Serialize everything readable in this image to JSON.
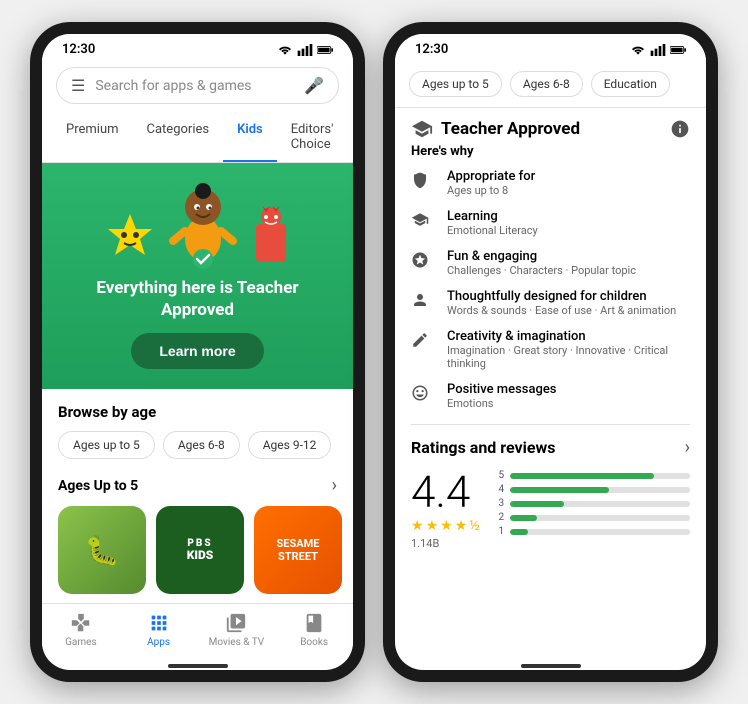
{
  "left_phone": {
    "status_time": "12:30",
    "search_placeholder": "Search for apps & games",
    "nav_tabs": [
      {
        "label": "Premium",
        "active": false
      },
      {
        "label": "Categories",
        "active": false
      },
      {
        "label": "Kids",
        "active": true
      },
      {
        "label": "Editors' Choice",
        "active": false
      }
    ],
    "hero": {
      "title": "Everything here is Teacher Approved",
      "learn_more_label": "Learn more"
    },
    "browse": {
      "title": "Browse by age",
      "chips": [
        {
          "label": "Ages up to 5",
          "active": false
        },
        {
          "label": "Ages 6-8",
          "active": false
        },
        {
          "label": "Ages 9-12",
          "active": false
        }
      ]
    },
    "ages_up_to_5": {
      "title": "Ages Up to 5",
      "apps": [
        {
          "name": "Caterpillar"
        },
        {
          "name": "PBS Kids"
        },
        {
          "name": "Sesame Street"
        }
      ]
    },
    "bottom_nav": [
      {
        "label": "Games",
        "active": false
      },
      {
        "label": "Apps",
        "active": true
      },
      {
        "label": "Movies & TV",
        "active": false
      },
      {
        "label": "Books",
        "active": false
      }
    ]
  },
  "right_phone": {
    "status_time": "12:30",
    "filter_chips": [
      {
        "label": "Ages up to 5",
        "active": false
      },
      {
        "label": "Ages 6-8",
        "active": false
      },
      {
        "label": "Education",
        "active": false
      }
    ],
    "teacher_section": {
      "title": "Teacher Approved",
      "heres_why": "Here's why",
      "reasons": [
        {
          "icon": "shield",
          "label": "Appropriate for",
          "detail": "Ages up to 8"
        },
        {
          "icon": "mortarboard",
          "label": "Learning",
          "detail": "Emotional Literacy"
        },
        {
          "icon": "star-outline",
          "label": "Fun & engaging",
          "detail": "Challenges · Characters · Popular topic"
        },
        {
          "icon": "child",
          "label": "Thoughtfully designed for children",
          "detail": "Words & sounds · Ease of use · Art & animation"
        },
        {
          "icon": "pencil",
          "label": "Creativity & imagination",
          "detail": "Imagination · Great story · Innovative · Critical thinking"
        },
        {
          "icon": "smile",
          "label": "Positive messages",
          "detail": "Emotions"
        }
      ]
    },
    "ratings": {
      "title": "Ratings and reviews",
      "score": "4.4",
      "stars_filled": 4,
      "stars_half": true,
      "count": "1.14B",
      "bars": [
        {
          "label": "5",
          "pct": 80
        },
        {
          "label": "4",
          "pct": 55
        },
        {
          "label": "3",
          "pct": 30
        },
        {
          "label": "2",
          "pct": 15
        },
        {
          "label": "1",
          "pct": 10
        }
      ]
    }
  }
}
